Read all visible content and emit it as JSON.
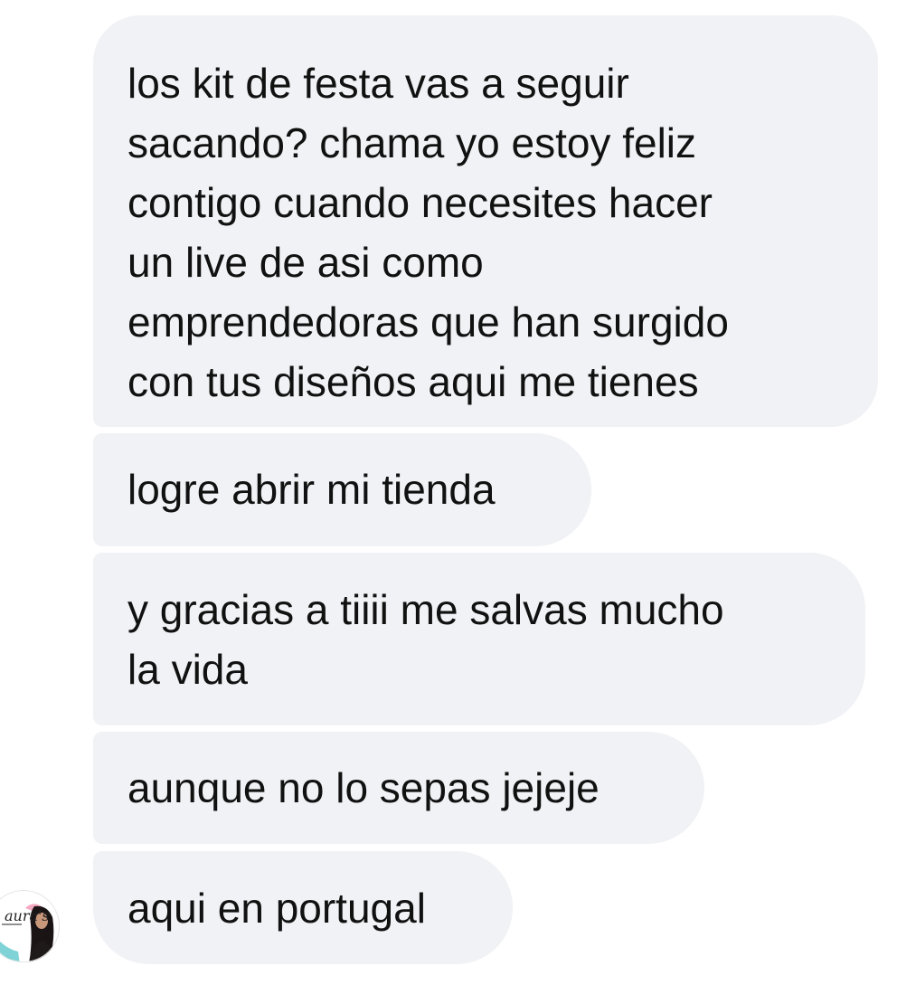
{
  "messages": [
    {
      "text": "los kit de festa vas a seguir\nsacando? chama yo estoy feliz\ncontigo cuando necesites hacer\nun live de asi como\nemprendedoras que han surgido\ncon tus diseños aqui me tienes"
    },
    {
      "text": "logre abrir mi tienda"
    },
    {
      "text": "y gracias a tiiii me salvas mucho\nla vida"
    },
    {
      "text": "aunque no lo sepas jejeje"
    },
    {
      "text": "aqui en portugal"
    }
  ],
  "sender": {
    "avatar_logo_text": "aura's"
  },
  "colors": {
    "bubble_bg": "#f1f2f5",
    "text": "#111111",
    "avatar_teal": "#7fd3d6",
    "avatar_pink": "#f3a7c0"
  }
}
